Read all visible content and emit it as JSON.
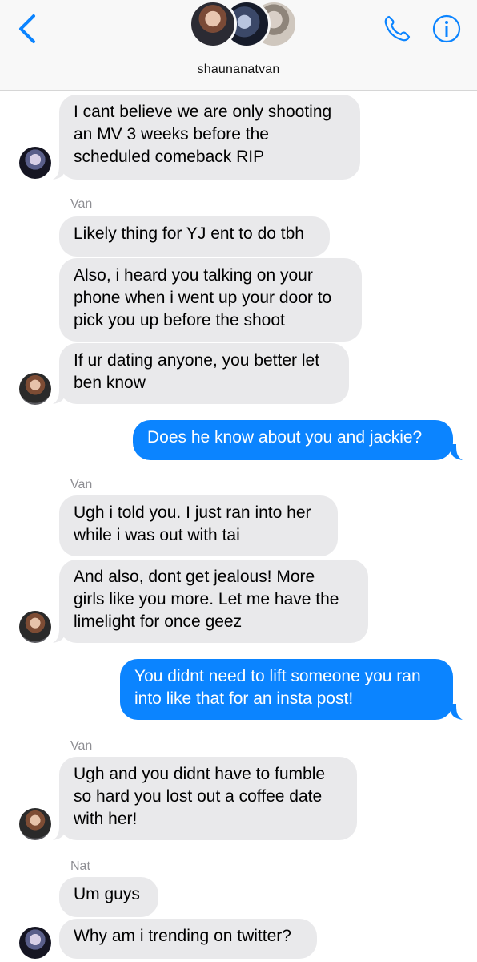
{
  "header": {
    "contact_name": "shaunanatvan"
  },
  "messages": [
    {
      "sender": "",
      "direction": "in",
      "avatar": "nat",
      "text": "I cant believe we are only shooting an MV 3 weeks before the scheduled comeback RIP"
    },
    {
      "sender": "Van",
      "direction": "in",
      "text": "Likely thing for YJ ent to do tbh"
    },
    {
      "sender": "",
      "direction": "in",
      "text": "Also, i heard you talking on your phone when i went up your door to pick you up before the shoot"
    },
    {
      "sender": "",
      "direction": "in",
      "avatar": "van",
      "text": "If ur dating anyone, you better let ben know"
    },
    {
      "sender": "",
      "direction": "out",
      "text": "Does he know about you and jackie?"
    },
    {
      "sender": "Van",
      "direction": "in",
      "text": "Ugh i told you. I just ran into her while  i was out with tai"
    },
    {
      "sender": "",
      "direction": "in",
      "avatar": "van",
      "text": "And also, dont get jealous! More girls like you more. Let me have the limelight for once geez"
    },
    {
      "sender": "",
      "direction": "out",
      "text": "You didnt need to lift someone you ran into like that for an insta post!"
    },
    {
      "sender": "Van",
      "direction": "in",
      "avatar": "van",
      "text": "Ugh and you didnt have to fumble so hard you lost out a coffee date with her!"
    },
    {
      "sender": "Nat",
      "direction": "in",
      "text": "Um guys"
    },
    {
      "sender": "",
      "direction": "in",
      "avatar": "nat",
      "text": "Why am i trending on twitter?"
    }
  ],
  "lines": {
    "m0": [
      "I cant believe we are only shooting",
      "an MV 3 weeks before the",
      "scheduled comeback RIP"
    ],
    "m2": [
      "Also, i heard you talking on your",
      "phone when i went up your door to",
      "pick you up before the shoot"
    ],
    "m3": [
      "If ur dating anyone, you better let",
      "ben know"
    ],
    "m5": [
      "Ugh i told you. I just ran into her",
      "while  i was out with tai"
    ],
    "m6": [
      "And also, dont get jealous! More",
      "girls like you more. Let me have the",
      "limelight for once geez"
    ],
    "m7": [
      "You didnt need to lift someone you ran",
      "into like that for an insta post!"
    ],
    "m8": [
      "Ugh and you didnt have to fumble",
      "so hard you lost out a coffee date",
      "with her!"
    ]
  },
  "colors": {
    "incoming_bubble": "#e9e9eb",
    "outgoing_bubble": "#0b84ff",
    "accent": "#0b84ff",
    "sender_label": "#8e8e93"
  },
  "icons": [
    "chevron-left-icon",
    "phone-icon",
    "info-icon"
  ]
}
